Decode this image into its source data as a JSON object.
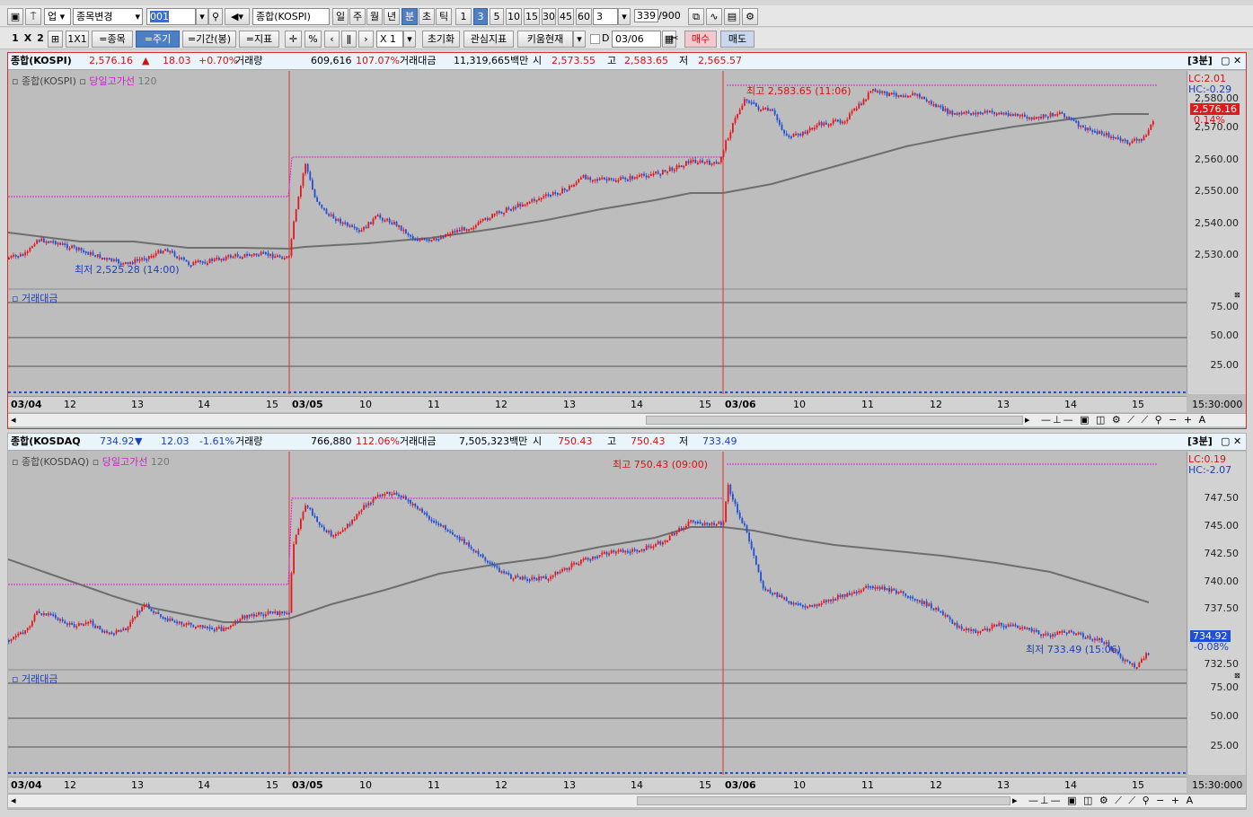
{
  "toolbar1": {
    "market": "업",
    "change_symbol": "종목변경",
    "code": "001",
    "symbol_name": "종합(KOSPI)",
    "period_labels": [
      "일",
      "주",
      "월",
      "년",
      "분",
      "초",
      "틱"
    ],
    "period_selected": "분",
    "interval_labels": [
      "1",
      "3",
      "5",
      "10",
      "15",
      "30",
      "45",
      "60"
    ],
    "interval_selected": "3",
    "interval_value": "3",
    "count": "339",
    "count_total": "/900"
  },
  "toolbar2": {
    "layout_1": "1",
    "layout_x": "X",
    "layout_2": "2",
    "layout_1x1": "1X1",
    "btn_symbol": "=종목",
    "btn_period": "=주기",
    "btn_range": "=기간(봉)",
    "btn_indicator": "=지표",
    "pct": "%",
    "zoom": "X 1",
    "reset": "초기화",
    "watch": "관심지표",
    "kiwoom": "키움현재",
    "d_label": "D",
    "date": "03/06",
    "buy": "매수",
    "sell": "매도"
  },
  "chart1": {
    "name": "종합(KOSPI)",
    "price": "2,576.16",
    "arrow": "▲",
    "change": "18.03",
    "change_pct": "+0.70%",
    "vol_label": "거래량",
    "vol": "609,616",
    "vol_pct": "107.07%",
    "amt_label": "거래대금",
    "amt": "11,319,665백만",
    "open_label": "시",
    "open": "2,573.55",
    "high_label": "고",
    "high": "2,583.65",
    "low_label": "저",
    "low": "2,565.57",
    "period_tag": "[3분]",
    "legend_main": "종합(KOSPI)",
    "legend_line": "당일고가선",
    "legend_ma": "120",
    "max_note": "최고 2,583.65 (11:06)",
    "min_note": "최저 2,525.28 (14:00)",
    "lc": "LC:2.01",
    "hc": "HC:-0.29",
    "last_price_tag": "2,576.16",
    "last_pct_tag": "0.14%",
    "sub_title": "거래대금",
    "yticks": [
      "2,580.00",
      "2,570.00",
      "2,560.00",
      "2,550.00",
      "2,540.00",
      "2,530.00"
    ],
    "sub_yticks": [
      "75.00",
      "50.00",
      "25.00"
    ],
    "time_label": "15:30:000"
  },
  "chart2": {
    "name": "종합(KOSDAQ",
    "price": "734.92",
    "arrow": "▼",
    "change": "12.03",
    "change_pct": "-1.61%",
    "vol_label": "거래량",
    "vol": "766,880",
    "vol_pct": "112.06%",
    "amt_label": "거래대금",
    "amt": "7,505,323백만",
    "open_label": "시",
    "open": "750.43",
    "high_label": "고",
    "high": "750.43",
    "low_label": "저",
    "low": "733.49",
    "period_tag": "[3분]",
    "legend_main": "종합(KOSDAQ)",
    "legend_line": "당일고가선",
    "legend_ma": "120",
    "max_note": "최고 750.43 (09:00)",
    "min_note": "최저 733.49 (15:06)",
    "lc": "LC:0.19",
    "hc": "HC:-2.07",
    "last_price_tag": "734.92",
    "last_pct_tag": "-0.08%",
    "sub_title": "거래대금",
    "yticks": [
      "747.50",
      "745.00",
      "742.50",
      "740.00",
      "737.50",
      "732.50"
    ],
    "sub_yticks": [
      "75.00",
      "50.00",
      "25.00"
    ],
    "time_label": "15:30:000"
  },
  "xaxis": [
    "03/04",
    "12",
    "13",
    "14",
    "15",
    "03/05",
    "10",
    "11",
    "12",
    "13",
    "14",
    "15",
    "03/06",
    "10",
    "11",
    "12",
    "13",
    "14",
    "15"
  ],
  "colors": {
    "up": "#e8141c",
    "down": "#1f4fd8",
    "ma": "#6e6e6e",
    "highline": "#e020e0",
    "divider": "#e03030"
  }
}
